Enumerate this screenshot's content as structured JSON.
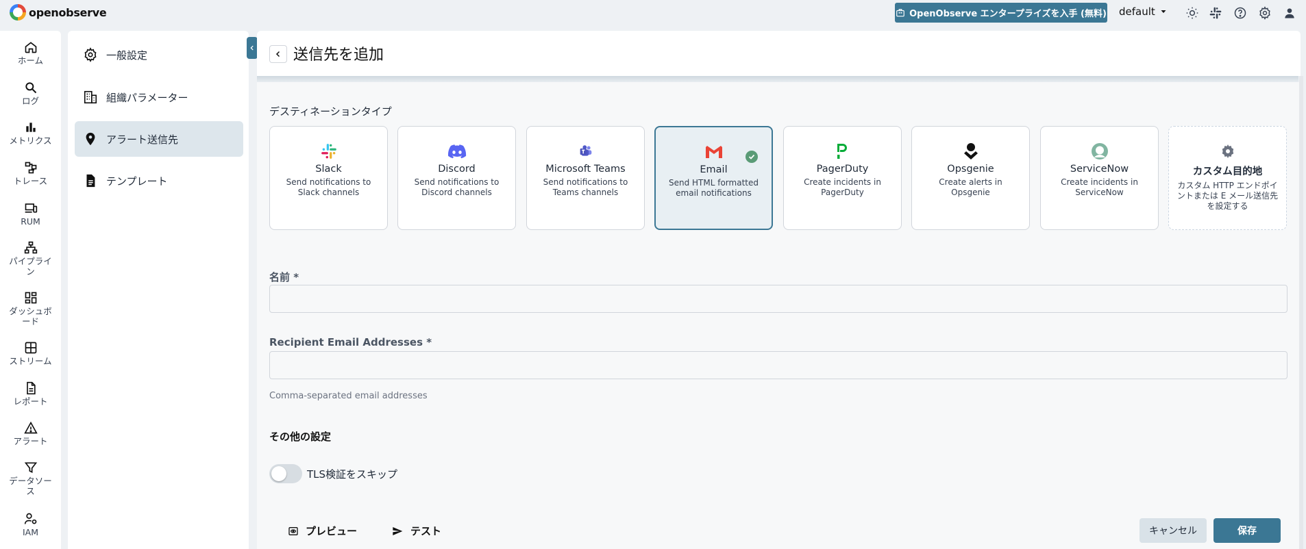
{
  "app": {
    "brand": "openobserve"
  },
  "topbar": {
    "enterprise_label": "OpenObserve エンタープライズを入手 (無料)",
    "org": "default"
  },
  "nav": [
    {
      "label": "ホーム",
      "icon": "home-icon"
    },
    {
      "label": "ログ",
      "icon": "search-icon"
    },
    {
      "label": "メトリクス",
      "icon": "bar-chart-icon"
    },
    {
      "label": "トレース",
      "icon": "trace-icon"
    },
    {
      "label": "RUM",
      "icon": "devices-icon"
    },
    {
      "label": "パイプライン",
      "icon": "pipeline-icon"
    },
    {
      "label": "ダッシュボード",
      "icon": "dashboard-icon"
    },
    {
      "label": "ストリーム",
      "icon": "grid-icon"
    },
    {
      "label": "レポート",
      "icon": "document-icon"
    },
    {
      "label": "アラート",
      "icon": "warning-icon"
    },
    {
      "label": "データソース",
      "icon": "filter-icon"
    },
    {
      "label": "IAM",
      "icon": "user-settings-icon"
    }
  ],
  "settings_menu": [
    {
      "label": "一般設定",
      "icon": "gear-icon"
    },
    {
      "label": "組織パラメーター",
      "icon": "building-icon"
    },
    {
      "label": "アラート送信先",
      "icon": "location-pin-icon",
      "active": true
    },
    {
      "label": "テンプレート",
      "icon": "document-icon"
    }
  ],
  "page": {
    "title": "送信先を追加"
  },
  "destination": {
    "section_label": "デスティネーションタイプ",
    "types": [
      {
        "name": "Slack",
        "desc": "Send notifications to Slack channels",
        "icon": "slack-icon"
      },
      {
        "name": "Discord",
        "desc": "Send notifications to Discord channels",
        "icon": "discord-icon"
      },
      {
        "name": "Microsoft Teams",
        "desc": "Send notifications to Teams channels",
        "icon": "teams-icon"
      },
      {
        "name": "Email",
        "desc": "Send HTML formatted email notifications",
        "icon": "gmail-icon",
        "selected": true
      },
      {
        "name": "PagerDuty",
        "desc": "Create incidents in PagerDuty",
        "icon": "pagerduty-icon"
      },
      {
        "name": "Opsgenie",
        "desc": "Create alerts in Opsgenie",
        "icon": "opsgenie-icon"
      },
      {
        "name": "ServiceNow",
        "desc": "Create incidents in ServiceNow",
        "icon": "servicenow-icon"
      },
      {
        "name": "カスタム目的地",
        "desc": "カスタム HTTP エンドポイントまたは E メール送信先を設定する",
        "icon": "gear-icon"
      }
    ]
  },
  "form": {
    "name_label": "名前 *",
    "name_value": "",
    "recipients_label": "Recipient Email Addresses *",
    "recipients_value": "",
    "recipients_hint": "Comma-separated email addresses",
    "other_settings": "その他の設定",
    "tls_label": "TLS検証をスキップ",
    "tls_enabled": false
  },
  "footer": {
    "preview_label": "プレビュー",
    "test_label": "テスト",
    "cancel_label": "キャンセル",
    "save_label": "保存"
  },
  "colors": {
    "primary": "#3b7794",
    "selected_card_bg": "#e8eff3",
    "success": "#5a9b76"
  }
}
